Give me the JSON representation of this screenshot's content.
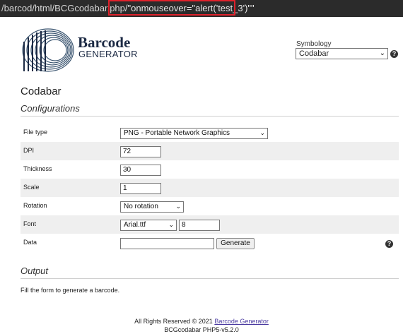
{
  "browser": {
    "url_prefix": "/barcod/html/BCGcodabar.php",
    "url_injected": "/\"onmouseover=\"alert('test_3')\"\""
  },
  "logo": {
    "title": "Barcode",
    "subtitle": "GENERATOR"
  },
  "symbology": {
    "label": "Symbology",
    "selected": "Codabar"
  },
  "page_title": "Codabar",
  "configurations": {
    "heading": "Configurations",
    "file_type": {
      "label": "File type",
      "value": "PNG - Portable Network Graphics"
    },
    "dpi": {
      "label": "DPI",
      "value": "72"
    },
    "thickness": {
      "label": "Thickness",
      "value": "30"
    },
    "scale": {
      "label": "Scale",
      "value": "1"
    },
    "rotation": {
      "label": "Rotation",
      "value": "No rotation"
    },
    "font": {
      "label": "Font",
      "family": "Arial.ttf",
      "size": "8"
    },
    "data": {
      "label": "Data",
      "value": "",
      "generate_label": "Generate"
    }
  },
  "output": {
    "heading": "Output",
    "message": "Fill the form to generate a barcode."
  },
  "footer": {
    "rights": "All Rights Reserved © 2021",
    "link": "Barcode Generator",
    "version": "BCGcodabar PHP5-v5.2.0"
  },
  "icons": {
    "help": "question-circle-icon",
    "dropdown": "chevron-down-icon"
  },
  "colors": {
    "highlight": "#e0212b",
    "logo_navy": "#1c2a44",
    "link": "#4a3aa0"
  }
}
